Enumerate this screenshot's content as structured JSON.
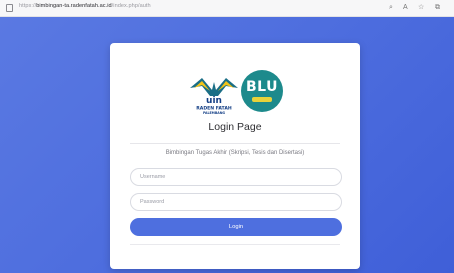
{
  "browser": {
    "url_prefix": "https://",
    "url_host": "bimbingan-ta.radenfatah.ac.id",
    "url_path": "/index.php/auth"
  },
  "logos": {
    "uin": {
      "line1": "uin",
      "line2": "RADEN FATAH",
      "line3": "PALEMBANG"
    },
    "blu": {
      "text": "BLU"
    }
  },
  "login": {
    "title": "Login Page",
    "subtitle": "Bimbingan Tugas Akhir (Skripsi, Tesis dan Disertasi)",
    "username_placeholder": "Username",
    "password_placeholder": "Password",
    "button_label": "Login"
  },
  "colors": {
    "background": "#4d6dde",
    "button": "#4e6fdf",
    "blu_logo": "#1d8a8c"
  }
}
